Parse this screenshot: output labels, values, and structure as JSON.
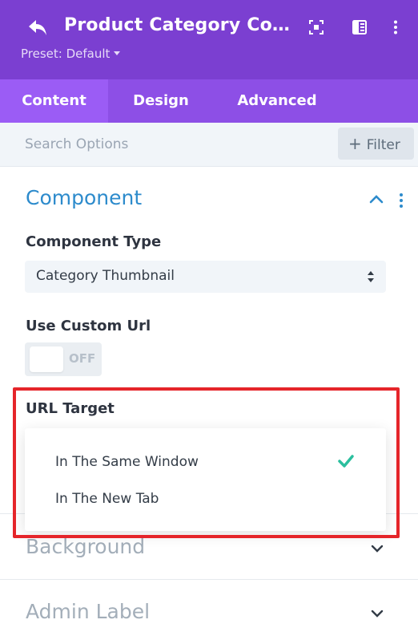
{
  "header": {
    "title": "Product Category Com...",
    "preset": "Preset: Default",
    "icons": [
      "undo-icon",
      "focus-icon",
      "sidebar-icon",
      "more-vertical-icon"
    ]
  },
  "tabs": [
    {
      "label": "Content",
      "active": true
    },
    {
      "label": "Design",
      "active": false
    },
    {
      "label": "Advanced",
      "active": false
    }
  ],
  "search": {
    "placeholder": "Search Options",
    "filter_label": "Filter"
  },
  "component_section": {
    "title": "Component",
    "expanded": true,
    "component_type": {
      "label": "Component Type",
      "value": "Category Thumbnail"
    },
    "use_custom_url": {
      "label": "Use Custom Url",
      "state": "OFF"
    },
    "url_target": {
      "label": "URL Target",
      "options": [
        "In The Same Window",
        "In The New Tab"
      ],
      "selected": "In The Same Window"
    }
  },
  "collapsed_sections": [
    {
      "title": "Background"
    },
    {
      "title": "Admin Label"
    }
  ],
  "colors": {
    "header": "#7b3fd1",
    "tabs": "#8d4fe6",
    "active_tab": "#9b5cf5",
    "accent_blue": "#2d8bcc",
    "check_green": "#2bbf9e",
    "highlight_red": "#e5252a"
  }
}
